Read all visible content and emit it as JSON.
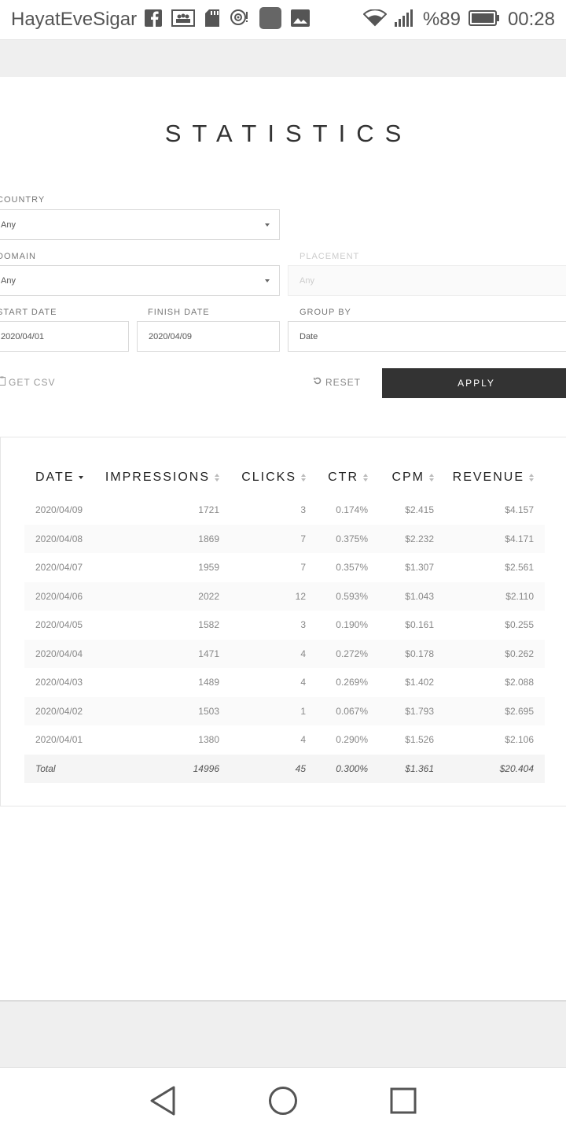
{
  "status_bar": {
    "carrier": "HayatEveSigar",
    "battery_pct": "%89",
    "clock": "00:28"
  },
  "page": {
    "title": "STATISTICS"
  },
  "filters": {
    "country": {
      "label": "COUNTRY",
      "value": "Any"
    },
    "domain": {
      "label": "DOMAIN",
      "value": "Any"
    },
    "placement": {
      "label": "PLACEMENT",
      "placeholder": "Any"
    },
    "start_date": {
      "label": "START DATE",
      "value": "2020/04/01"
    },
    "finish_date": {
      "label": "FINISH DATE",
      "value": "2020/04/09"
    },
    "group_by": {
      "label": "GROUP BY",
      "value": "Date"
    }
  },
  "actions": {
    "get_csv": "GET CSV",
    "reset": "RESET",
    "apply": "APPLY"
  },
  "table": {
    "columns": [
      "DATE",
      "IMPRESSIONS",
      "CLICKS",
      "CTR",
      "CPM",
      "REVENUE"
    ],
    "rows": [
      [
        "2020/04/09",
        "1721",
        "3",
        "0.174%",
        "$2.415",
        "$4.157"
      ],
      [
        "2020/04/08",
        "1869",
        "7",
        "0.375%",
        "$2.232",
        "$4.171"
      ],
      [
        "2020/04/07",
        "1959",
        "7",
        "0.357%",
        "$1.307",
        "$2.561"
      ],
      [
        "2020/04/06",
        "2022",
        "12",
        "0.593%",
        "$1.043",
        "$2.110"
      ],
      [
        "2020/04/05",
        "1582",
        "3",
        "0.190%",
        "$0.161",
        "$0.255"
      ],
      [
        "2020/04/04",
        "1471",
        "4",
        "0.272%",
        "$0.178",
        "$0.262"
      ],
      [
        "2020/04/03",
        "1489",
        "4",
        "0.269%",
        "$1.402",
        "$2.088"
      ],
      [
        "2020/04/02",
        "1503",
        "1",
        "0.067%",
        "$1.793",
        "$2.695"
      ],
      [
        "2020/04/01",
        "1380",
        "4",
        "0.290%",
        "$1.526",
        "$2.106"
      ]
    ],
    "total": [
      "Total",
      "14996",
      "45",
      "0.300%",
      "$1.361",
      "$20.404"
    ]
  },
  "colors": {
    "apply_bg": "#333333",
    "text_muted": "#888888",
    "gray_band": "#efefef"
  }
}
